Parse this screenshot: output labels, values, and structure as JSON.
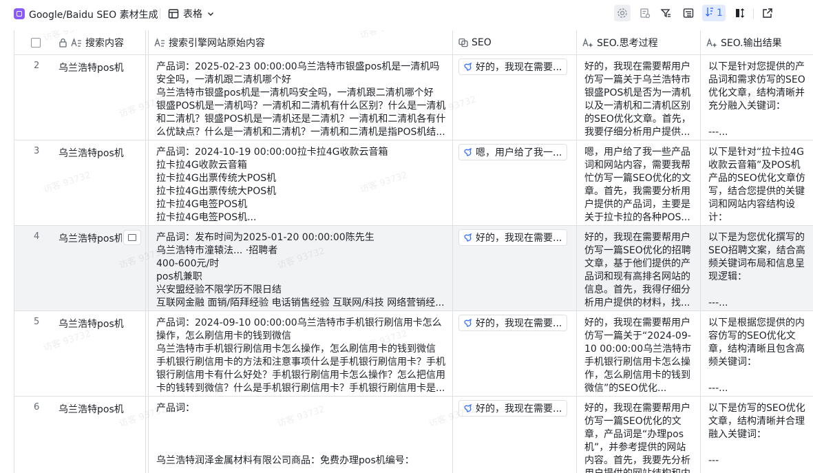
{
  "app": {
    "title": "Google/Baidu SEO 素材生成",
    "view_label": "表格",
    "row_height_count": "1",
    "watermark_text": "访客 93732"
  },
  "columns": [
    {
      "label": "搜索内容"
    },
    {
      "label": "搜索引擎网站原始内容"
    },
    {
      "label": "SEO"
    },
    {
      "label": "SEO.思考过程"
    },
    {
      "label": "SEO.输出结果"
    }
  ],
  "rows": [
    {
      "num": "2",
      "name": "乌兰浩特pos机",
      "content": [
        "产品词：2025-02-23 00:00:00乌兰浩特市银盛pos机是一清机吗安全吗，一清机跟二清机哪个好",
        "乌兰浩特市银盛pos机是一清机吗安全吗，一清机跟二清机哪个好",
        "银盛POS机是一清机吗？一清机和二清机有什么区别？什么是一清机和二清机？银盛POS机是一清机还是二清机？一清机和二清机各有什么优缺点？什么是一清机和二清机？一清机和二清机是指POS机结..."
      ],
      "seo": "好的，我现在需要...",
      "think": "好的，我现在需要帮用户仿写一篇关于乌兰浩特市银盛POS机是否为一清机以及一清机和二清机区别的SEO优化文章。首先，我要仔细分析用户提供...",
      "output": [
        "以下是针对您提供的产品词和需求仿写的SEO优化文章，结构清晰并充分融入关键词：",
        "",
        "---..."
      ]
    },
    {
      "num": "3",
      "name": "乌兰浩特pos机",
      "content": [
        "产品词：2024-10-19 00:00:00拉卡拉4G收款云音箱",
        "拉卡拉4G收款云音箱",
        "拉卡拉4G出票传统大POS机",
        "拉卡拉4G出票传统大POS机",
        "拉卡拉4G电签POS机",
        "拉卡拉4G电签POS机..."
      ],
      "seo": "嗯，用户给了我一...",
      "think": "嗯，用户给了我一些产品词和网站内容，需要我帮忙仿写一篇SEO优化的文章。首先，我需要分析用户提供的产品词，主要是关于拉卡拉的各种POS...",
      "output": [
        "以下是针对“拉卡拉4G收款云音箱”及POS机产品的SEO优化文章仿写，结合您提供的关键词和网站内容结构设计：",
        "..."
      ]
    },
    {
      "num": "4",
      "name": "乌兰浩特pos机",
      "content": [
        "产品词：发布时间为2025-01-20 00:00:00陈先生",
        "乌兰浩特市潼辕法... ·招聘者",
        "400-600元/时",
        "pos机兼职",
        "兴安盟经验不限学历不限日结",
        "互联网金融 面销/陌拜经验 电话销售经验 互联网/科技 网络营销经..."
      ],
      "seo": "好的，我现在需要...",
      "think": "好的，我现在需要帮用户仿写一篇SEO优化的招聘文章，基于他们提供的产品词和现有高排名网站的信息。首先，我得仔细分析用户提供的材料，找...",
      "output": [
        "以下是为您优化撰写的SEO招聘文案，结合高频关键词布局和信息呈现逻辑：",
        "",
        "---..."
      ]
    },
    {
      "num": "5",
      "name": "乌兰浩特pos机",
      "content": [
        "产品词：2024-09-10 00:00:00乌兰浩特市手机银行刷信用卡怎么操作，怎么刷信用卡的钱到微信",
        "乌兰浩特市手机银行刷信用卡怎么操作，怎么刷信用卡的钱到微信",
        "手机银行刷信用卡的方法和注意事项什么是手机银行刷信用卡？手机银行刷信用卡有什么好处？手机银行刷信用卡怎么操作？怎么把信用卡的钱转到微信？什么是手机银行刷信用卡？手机银行刷信用卡是..."
      ],
      "seo": "好的，我现在需要...",
      "think": "好的，我现在需要帮用户仿写一篇关于“2024-09-10 00:00:00乌兰浩特市手机银行刷信用卡怎么操作，怎么刷信用卡的钱到微信”的SEO优化...",
      "output": [
        "以下是根据您提供的内容仿写的SEO优化文章，结构清晰且包含高频关键词：",
        "",
        "---..."
      ]
    },
    {
      "num": "6",
      "name": "乌兰浩特pos机",
      "content": [
        "产品词：",
        "",
        "",
        "",
        "乌兰浩特润泽金属材料有限公司商品：免费办理pos机编号："
      ],
      "seo": "好的，我现在需要...",
      "think": "好的，我现在需要帮用户仿写一篇SEO优化的文章，产品词是“办理pos机”，并参考提供的网站内容。首先，我要先分析用户提供的网站结构和内容...",
      "output": [
        "以下是仿写的SEO优化文章，结构清晰并合理融入关键词：",
        "",
        "---"
      ]
    }
  ]
}
